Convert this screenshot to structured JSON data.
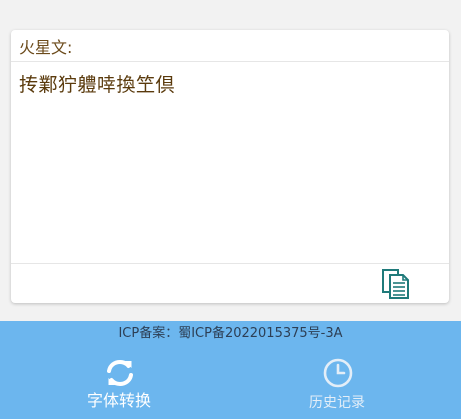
{
  "card": {
    "label": "火星文:",
    "output_text": "抟鄴狞軆啈換笁倶"
  },
  "footer": {
    "icp_text": "ICP备案：蜀ICP备2022015375号-3A"
  },
  "nav": {
    "items": [
      {
        "label": "字体转换",
        "icon": "refresh-icon",
        "active": true
      },
      {
        "label": "历史记录",
        "icon": "clock-icon",
        "active": false
      }
    ]
  },
  "colors": {
    "nav_background": "#6cb6ee",
    "label_text": "#6b4a1a",
    "output_text": "#5a3a0c",
    "copy_icon": "#1f7a7a"
  }
}
